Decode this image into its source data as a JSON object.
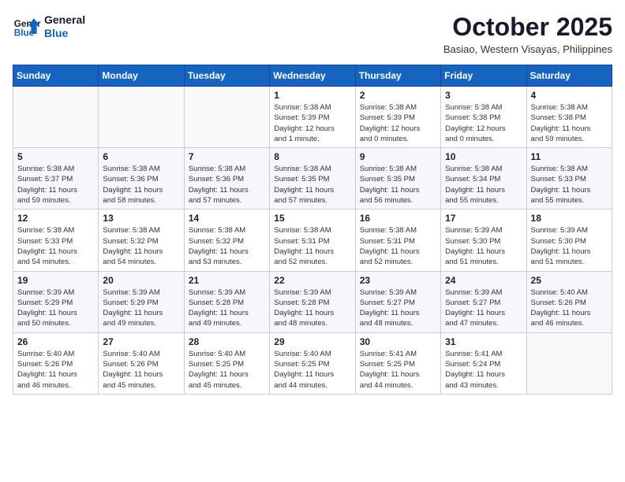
{
  "header": {
    "logo_line1": "General",
    "logo_line2": "Blue",
    "month": "October 2025",
    "location": "Basiao, Western Visayas, Philippines"
  },
  "weekdays": [
    "Sunday",
    "Monday",
    "Tuesday",
    "Wednesday",
    "Thursday",
    "Friday",
    "Saturday"
  ],
  "weeks": [
    [
      {
        "day": "",
        "detail": ""
      },
      {
        "day": "",
        "detail": ""
      },
      {
        "day": "",
        "detail": ""
      },
      {
        "day": "1",
        "detail": "Sunrise: 5:38 AM\nSunset: 5:39 PM\nDaylight: 12 hours\nand 1 minute."
      },
      {
        "day": "2",
        "detail": "Sunrise: 5:38 AM\nSunset: 5:39 PM\nDaylight: 12 hours\nand 0 minutes."
      },
      {
        "day": "3",
        "detail": "Sunrise: 5:38 AM\nSunset: 5:38 PM\nDaylight: 12 hours\nand 0 minutes."
      },
      {
        "day": "4",
        "detail": "Sunrise: 5:38 AM\nSunset: 5:38 PM\nDaylight: 11 hours\nand 59 minutes."
      }
    ],
    [
      {
        "day": "5",
        "detail": "Sunrise: 5:38 AM\nSunset: 5:37 PM\nDaylight: 11 hours\nand 59 minutes."
      },
      {
        "day": "6",
        "detail": "Sunrise: 5:38 AM\nSunset: 5:36 PM\nDaylight: 11 hours\nand 58 minutes."
      },
      {
        "day": "7",
        "detail": "Sunrise: 5:38 AM\nSunset: 5:36 PM\nDaylight: 11 hours\nand 57 minutes."
      },
      {
        "day": "8",
        "detail": "Sunrise: 5:38 AM\nSunset: 5:35 PM\nDaylight: 11 hours\nand 57 minutes."
      },
      {
        "day": "9",
        "detail": "Sunrise: 5:38 AM\nSunset: 5:35 PM\nDaylight: 11 hours\nand 56 minutes."
      },
      {
        "day": "10",
        "detail": "Sunrise: 5:38 AM\nSunset: 5:34 PM\nDaylight: 11 hours\nand 55 minutes."
      },
      {
        "day": "11",
        "detail": "Sunrise: 5:38 AM\nSunset: 5:33 PM\nDaylight: 11 hours\nand 55 minutes."
      }
    ],
    [
      {
        "day": "12",
        "detail": "Sunrise: 5:38 AM\nSunset: 5:33 PM\nDaylight: 11 hours\nand 54 minutes."
      },
      {
        "day": "13",
        "detail": "Sunrise: 5:38 AM\nSunset: 5:32 PM\nDaylight: 11 hours\nand 54 minutes."
      },
      {
        "day": "14",
        "detail": "Sunrise: 5:38 AM\nSunset: 5:32 PM\nDaylight: 11 hours\nand 53 minutes."
      },
      {
        "day": "15",
        "detail": "Sunrise: 5:38 AM\nSunset: 5:31 PM\nDaylight: 11 hours\nand 52 minutes."
      },
      {
        "day": "16",
        "detail": "Sunrise: 5:38 AM\nSunset: 5:31 PM\nDaylight: 11 hours\nand 52 minutes."
      },
      {
        "day": "17",
        "detail": "Sunrise: 5:39 AM\nSunset: 5:30 PM\nDaylight: 11 hours\nand 51 minutes."
      },
      {
        "day": "18",
        "detail": "Sunrise: 5:39 AM\nSunset: 5:30 PM\nDaylight: 11 hours\nand 51 minutes."
      }
    ],
    [
      {
        "day": "19",
        "detail": "Sunrise: 5:39 AM\nSunset: 5:29 PM\nDaylight: 11 hours\nand 50 minutes."
      },
      {
        "day": "20",
        "detail": "Sunrise: 5:39 AM\nSunset: 5:29 PM\nDaylight: 11 hours\nand 49 minutes."
      },
      {
        "day": "21",
        "detail": "Sunrise: 5:39 AM\nSunset: 5:28 PM\nDaylight: 11 hours\nand 49 minutes."
      },
      {
        "day": "22",
        "detail": "Sunrise: 5:39 AM\nSunset: 5:28 PM\nDaylight: 11 hours\nand 48 minutes."
      },
      {
        "day": "23",
        "detail": "Sunrise: 5:39 AM\nSunset: 5:27 PM\nDaylight: 11 hours\nand 48 minutes."
      },
      {
        "day": "24",
        "detail": "Sunrise: 5:39 AM\nSunset: 5:27 PM\nDaylight: 11 hours\nand 47 minutes."
      },
      {
        "day": "25",
        "detail": "Sunrise: 5:40 AM\nSunset: 5:26 PM\nDaylight: 11 hours\nand 46 minutes."
      }
    ],
    [
      {
        "day": "26",
        "detail": "Sunrise: 5:40 AM\nSunset: 5:26 PM\nDaylight: 11 hours\nand 46 minutes."
      },
      {
        "day": "27",
        "detail": "Sunrise: 5:40 AM\nSunset: 5:26 PM\nDaylight: 11 hours\nand 45 minutes."
      },
      {
        "day": "28",
        "detail": "Sunrise: 5:40 AM\nSunset: 5:25 PM\nDaylight: 11 hours\nand 45 minutes."
      },
      {
        "day": "29",
        "detail": "Sunrise: 5:40 AM\nSunset: 5:25 PM\nDaylight: 11 hours\nand 44 minutes."
      },
      {
        "day": "30",
        "detail": "Sunrise: 5:41 AM\nSunset: 5:25 PM\nDaylight: 11 hours\nand 44 minutes."
      },
      {
        "day": "31",
        "detail": "Sunrise: 5:41 AM\nSunset: 5:24 PM\nDaylight: 11 hours\nand 43 minutes."
      },
      {
        "day": "",
        "detail": ""
      }
    ]
  ]
}
